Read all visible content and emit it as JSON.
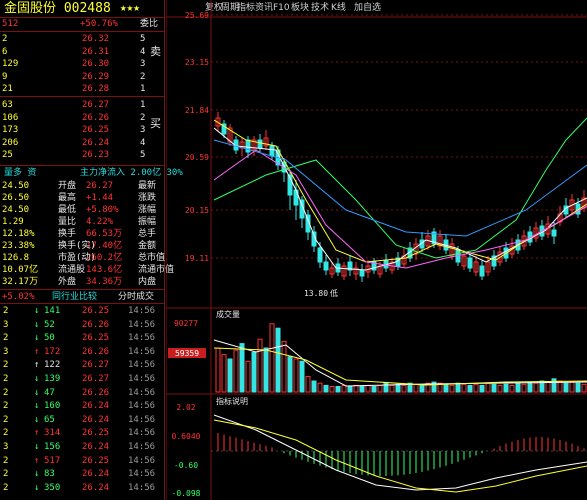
{
  "quote": {
    "title": "金固股份 002488",
    "stars": "★★★",
    "weibi_label": "委比",
    "weibi_value": "+50.76%",
    "weicha_value": "512",
    "sell_label": "卖",
    "buy_label": "买",
    "sells": [
      {
        "lvl": "5",
        "price": "26.32",
        "vol": "2"
      },
      {
        "lvl": "4",
        "price": "26.31",
        "vol": "6"
      },
      {
        "lvl": "3",
        "price": "26.30",
        "vol": "129"
      },
      {
        "lvl": "2",
        "price": "26.29",
        "vol": "9"
      },
      {
        "lvl": "1",
        "price": "26.28",
        "vol": "21"
      }
    ],
    "buys": [
      {
        "lvl": "1",
        "price": "26.27",
        "vol": "63"
      },
      {
        "lvl": "2",
        "price": "26.26",
        "vol": "106"
      },
      {
        "lvl": "3",
        "price": "26.25",
        "vol": "173"
      },
      {
        "lvl": "4",
        "price": "26.24",
        "vol": "206"
      },
      {
        "lvl": "5",
        "price": "26.23",
        "vol": "25"
      }
    ],
    "info_header": "主力净流入 2.00亿 30%",
    "info_header_right": "量多 资",
    "stats": [
      {
        "l1": "最新",
        "v1": "26.27",
        "l2": "开盘",
        "v2": "24.50"
      },
      {
        "l1": "涨跌",
        "v1": "+1.44",
        "l2": "最高",
        "v2": "26.50"
      },
      {
        "l1": "涨幅",
        "v1": "+5.80%",
        "l2": "最低",
        "v2": "24.50"
      },
      {
        "l1": "振幅",
        "v1": "4.22%",
        "l2": "量比",
        "v2": "1.29"
      },
      {
        "l1": "总手",
        "v1": "66.53万",
        "l2": "换手",
        "v2": "12.18%"
      },
      {
        "l1": "金额",
        "v1": "17.40亿",
        "l2": "换手(实)",
        "v2": "23.38%"
      },
      {
        "l1": "总市值",
        "v1": "260.2亿",
        "l2": "市盈(动)",
        "v2": "126.8"
      },
      {
        "l1": "流通市值",
        "v1": "143.6亿",
        "l2": "流通股",
        "v2": "10.07亿"
      },
      {
        "l1": "内盘",
        "v1": "34.36万",
        "l2": "外盘",
        "v2": "32.17万"
      }
    ],
    "trades_header_left": "分时成交",
    "trades_header_right": "同行业比较",
    "trades_header_pct": "+5.02%",
    "trades": [
      {
        "time": "14:56",
        "price": "26.25",
        "vol": "141",
        "arrow": "↓",
        "num": "2",
        "dir": "dn"
      },
      {
        "time": "14:56",
        "price": "26.26",
        "vol": "52",
        "arrow": "↓",
        "num": "3",
        "dir": "dn"
      },
      {
        "time": "14:56",
        "price": "26.25",
        "vol": "50",
        "arrow": "↓",
        "num": "2",
        "dir": "dn"
      },
      {
        "time": "14:56",
        "price": "26.26",
        "vol": "172",
        "arrow": "↑",
        "num": "3",
        "dir": "up"
      },
      {
        "time": "14:56",
        "price": "26.27",
        "vol": "122",
        "arrow": "↑",
        "num": "2",
        "dir": "wt"
      },
      {
        "time": "14:56",
        "price": "26.27",
        "vol": "139",
        "arrow": "↓",
        "num": "2",
        "dir": "dn"
      },
      {
        "time": "14:56",
        "price": "26.26",
        "vol": "47",
        "arrow": "↓",
        "num": "2",
        "dir": "dn"
      },
      {
        "time": "14:56",
        "price": "26.24",
        "vol": "160",
        "arrow": "↓",
        "num": "2",
        "dir": "dn"
      },
      {
        "time": "14:56",
        "price": "26.24",
        "vol": "65",
        "arrow": "↓",
        "num": "2",
        "dir": "dn"
      },
      {
        "time": "14:56",
        "price": "26.25",
        "vol": "314",
        "arrow": "↑",
        "num": "2",
        "dir": "up"
      },
      {
        "time": "14:56",
        "price": "26.24",
        "vol": "156",
        "arrow": "↓",
        "num": "3",
        "dir": "dn"
      },
      {
        "time": "14:56",
        "price": "26.25",
        "vol": "517",
        "arrow": "↑",
        "num": "2",
        "dir": "up"
      },
      {
        "time": "14:56",
        "price": "26.24",
        "vol": "83",
        "arrow": "↓",
        "num": "2",
        "dir": "dn"
      },
      {
        "time": "14:56",
        "price": "26.24",
        "vol": "350",
        "arrow": "↓",
        "num": "2",
        "dir": "dn"
      }
    ]
  },
  "chart": {
    "toolbar": [
      "加自选",
      "K线",
      "技术",
      "板块",
      "F10",
      "资讯",
      "指标",
      "周期",
      "复权"
    ],
    "price_ticks": [
      "25.69",
      "23.15",
      "21.84",
      "20.59",
      "20.15",
      "19.11"
    ],
    "low_label": "13.80",
    "low_marker": "低",
    "vol_tab": "成交量",
    "vol_max": "90277",
    "vol_current": "59359",
    "ind_tab": "指标说明",
    "ind_ticks": [
      "2.02",
      "0.6040",
      "-0.60",
      "-0.098"
    ],
    "colors": {
      "up": "#ff3333",
      "down": "#33e6e6",
      "ma5": "#ffffff",
      "ma10": "#ffff33",
      "ma20": "#ff66ff",
      "ma60": "#33ff66",
      "ma120": "#3399ff"
    }
  }
}
